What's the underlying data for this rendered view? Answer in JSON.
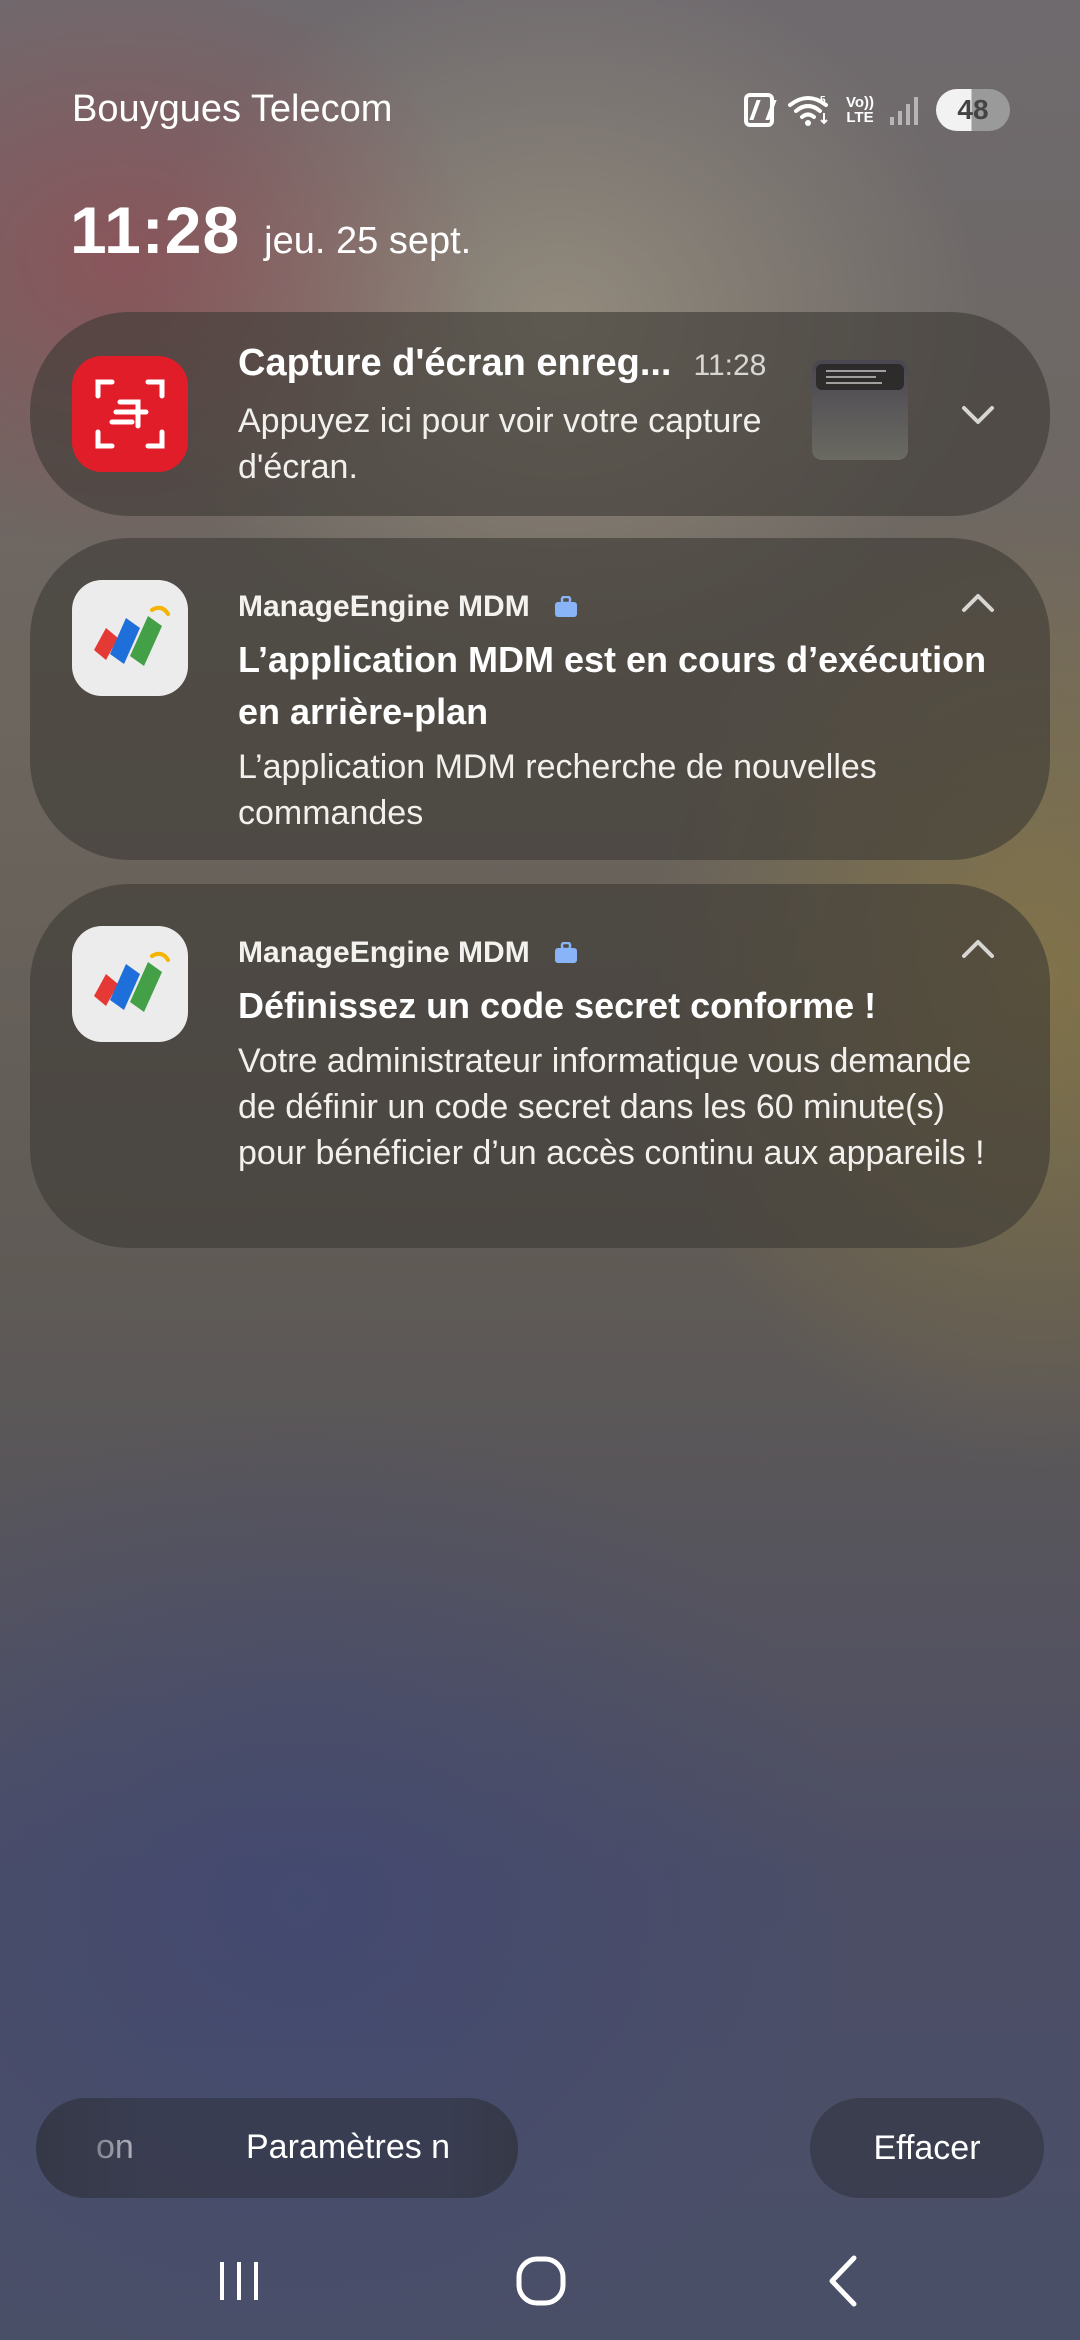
{
  "status_bar": {
    "carrier": "Bouygues Telecom",
    "volte_top": "Vo))",
    "volte_bottom": "LTE",
    "battery": "48"
  },
  "clock": {
    "time": "11:28",
    "date": "jeu. 25 sept."
  },
  "notifications": [
    {
      "title": "Capture d'écran enreg...",
      "time": "11:28",
      "text": "Appuyez ici pour voir votre capture d'écran.",
      "icon": "screenshot-icon",
      "icon_color": "#e21d2a"
    },
    {
      "app_name": "ManageEngine MDM",
      "title": "L’application MDM est en cours d’exécution en arrière-plan",
      "text": "L’application MDM recherche de nouvelles commandes",
      "icon": "manageengine-icon"
    },
    {
      "app_name": "ManageEngine MDM",
      "title": "Définissez un code secret conforme !",
      "text": "Votre administrateur informatique vous demande de définir un code secret dans les 60 minute(s) pour bénéficier d’un accès continu aux appareils !",
      "icon": "manageengine-icon"
    }
  ],
  "actions": {
    "peek_label": "on",
    "settings_label": "Paramètres n",
    "clear_label": "Effacer"
  },
  "colors": {
    "work_badge": "#8ab4f8",
    "screenshot_red": "#e21d2a"
  }
}
